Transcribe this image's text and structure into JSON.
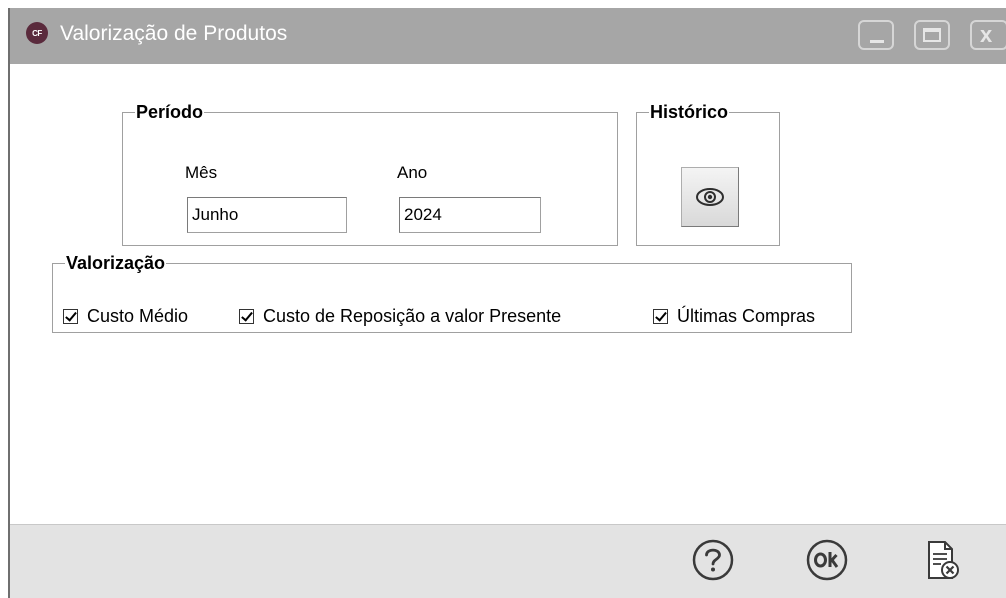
{
  "window": {
    "title": "Valorização de Produtos",
    "icon_text": "CF",
    "controls": [
      "minimize-icon",
      "maximize-icon",
      "close-icon"
    ]
  },
  "periodo": {
    "legend": "Período",
    "mes_label": "Mês",
    "mes_value": "Junho",
    "ano_label": "Ano",
    "ano_value": "2024"
  },
  "historico": {
    "legend": "Histórico",
    "button_icon": "eye-icon"
  },
  "valorizacao": {
    "legend": "Valorização",
    "options": [
      {
        "label": "Custo Médio",
        "checked": true
      },
      {
        "label": "Custo de Reposição a valor Presente",
        "checked": true
      },
      {
        "label": "Últimas Compras",
        "checked": true
      }
    ]
  },
  "footer": {
    "buttons": [
      "help-icon",
      "ok-icon",
      "cancel-document-icon"
    ]
  },
  "colors": {
    "titlebar": "#a6a6a6",
    "footer": "#e3e3e3",
    "icon_stroke": "#3a3a3a"
  }
}
